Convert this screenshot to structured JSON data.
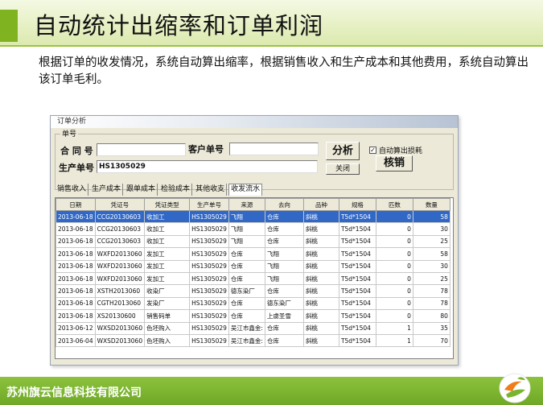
{
  "slide": {
    "title": "自动统计出缩率和订单利润",
    "description": "根据订单的收发情况，系统自动算出缩率，根据销售收入和生产成本和其他费用，系统自动算出该订单毛利。",
    "footer": "苏州旗云信息科技有限公司"
  },
  "window": {
    "title": "订单分析",
    "group_label": "单号",
    "contract_label": "合 同 号",
    "customer_order_label": "客户单号",
    "production_order_label": "生产单号",
    "contract_value": "",
    "customer_order_value": "",
    "production_order_value": "HS1305029",
    "analyze_button": "分析",
    "close_button": "关闭",
    "verify_button": "核销",
    "auto_calc_label": "自动算出损耗",
    "auto_calc_checked": true
  },
  "tabs": [
    "销售收入",
    "生产成本",
    "跟单成本",
    "检验成本",
    "其他收支",
    "收发流水"
  ],
  "active_tab": 5,
  "table": {
    "headers": [
      "日期",
      "凭证号",
      "凭证类型",
      "生产单号",
      "来源",
      "去向",
      "品种",
      "规格",
      "匹数",
      "数量"
    ],
    "rows": [
      [
        "2013-06-18",
        "CCG20130603",
        "收加工",
        "HS1305029",
        "飞翔",
        "仓库",
        "斜桃",
        "T5d*1504",
        "0",
        "58"
      ],
      [
        "2013-06-18",
        "CCG20130603",
        "收加工",
        "HS1305029",
        "飞翔",
        "仓库",
        "斜桃",
        "T5d*1504",
        "0",
        "30"
      ],
      [
        "2013-06-18",
        "CCG20130603",
        "收加工",
        "HS1305029",
        "飞翔",
        "仓库",
        "斜桃",
        "T5d*1504",
        "0",
        "25"
      ],
      [
        "2013-06-18",
        "WXFD2013060",
        "发加工",
        "HS1305029",
        "仓库",
        "飞翔",
        "斜桃",
        "T5d*1504",
        "0",
        "58"
      ],
      [
        "2013-06-18",
        "WXFD2013060",
        "发加工",
        "HS1305029",
        "仓库",
        "飞翔",
        "斜桃",
        "T5d*1504",
        "0",
        "30"
      ],
      [
        "2013-06-18",
        "WXFD2013060",
        "发加工",
        "HS1305029",
        "仓库",
        "飞翔",
        "斜桃",
        "T5d*1504",
        "0",
        "25"
      ],
      [
        "2013-06-18",
        "XSTH2013060",
        "收染厂",
        "HS1305029",
        "德东染厂",
        "仓库",
        "斜桃",
        "T5d*1504",
        "0",
        "78"
      ],
      [
        "2013-06-18",
        "CGTH2013060",
        "发染厂",
        "HS1305029",
        "仓库",
        "德东染厂",
        "斜桃",
        "T5d*1504",
        "0",
        "78"
      ],
      [
        "2013-06-18",
        "XS20130600",
        "销售码单",
        "HS1305029",
        "仓库",
        "上虞圣雪",
        "斜桃",
        "T5d*1504",
        "0",
        "80"
      ],
      [
        "2013-06-12",
        "WXSD2013060",
        "色坯购入",
        "HS1305029",
        "吴江市鑫金:",
        "仓库",
        "斜桃",
        "T5d*1504",
        "1",
        "35"
      ],
      [
        "2013-06-04",
        "WXSD2013060",
        "色坯购入",
        "HS1305029",
        "吴江市鑫金:",
        "仓库",
        "斜桃",
        "T5d*1504",
        "1",
        "70"
      ]
    ]
  },
  "colors": {
    "accent_green": "#7fb31f",
    "footer_green": "#7ab530",
    "selection_blue": "#3168c6"
  }
}
